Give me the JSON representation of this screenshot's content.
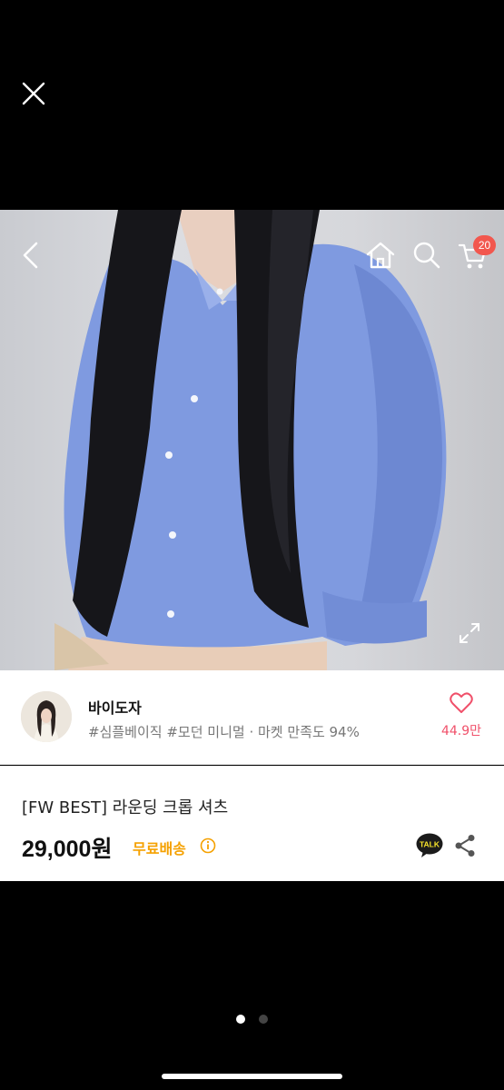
{
  "viewer": {
    "close_icon": "close-icon",
    "page_indicator": {
      "total": 2,
      "current": 1
    }
  },
  "photo_nav": {
    "back_icon": "chevron-left-icon",
    "home_icon": "home-icon",
    "search_icon": "search-icon",
    "cart_icon": "cart-icon",
    "cart_count": "20",
    "expand_icon": "expand-icon"
  },
  "seller": {
    "name": "바이도자",
    "tags": "#심플베이직 #모던 미니멀 · 마켓 만족도 94%",
    "likes": "44.9만"
  },
  "product": {
    "title": "[FW BEST] 라운딩 크롭 셔츠",
    "price": "29,000원",
    "shipping": "무료배송"
  },
  "colors": {
    "accent_red": "#f2574e",
    "like_pink": "#f0506a",
    "shipping_orange": "#f5a100",
    "background": "#000000"
  }
}
